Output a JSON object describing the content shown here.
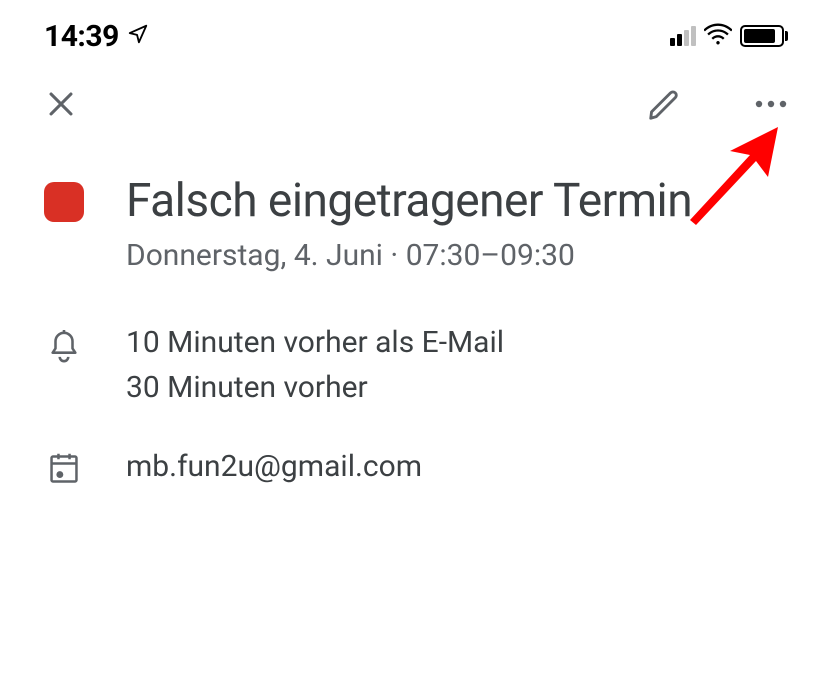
{
  "statusBar": {
    "time": "14:39"
  },
  "toolbar": {
    "close": "Close",
    "edit": "Edit",
    "more": "More"
  },
  "event": {
    "colorBadge": "#d93025",
    "title": "Falsch eingetragener Termin",
    "datetime": "Donnerstag, 4. Juni · 07:30–09:30",
    "reminders": [
      "10 Minuten vorher als E-Mail",
      "30 Minuten vorher"
    ],
    "calendar": "mb.fun2u@gmail.com"
  }
}
